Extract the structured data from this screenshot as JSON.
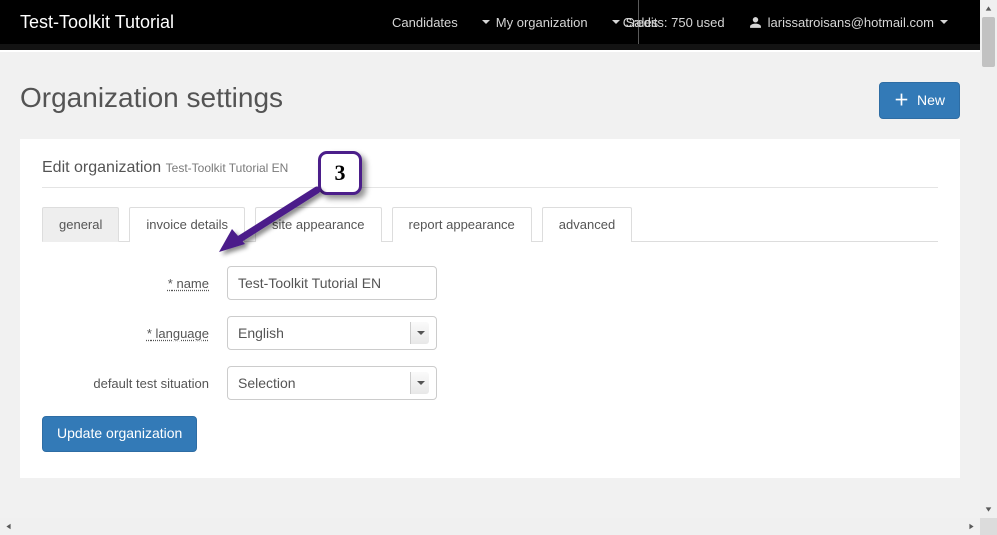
{
  "header": {
    "brand": "Test-Toolkit Tutorial",
    "nav_center": [
      {
        "label": "Candidates",
        "dropdown": false
      },
      {
        "label": "My organization",
        "dropdown": true
      },
      {
        "label": "Sales",
        "dropdown": true
      }
    ],
    "credits_label": "Credits: 750 used",
    "user_email": "larissatroisans@hotmail.com"
  },
  "page": {
    "title": "Organization settings",
    "new_button_label": "New"
  },
  "panel": {
    "heading": "Edit organization",
    "subheading": "Test-Toolkit Tutorial EN"
  },
  "tabs": [
    "general",
    "invoice details",
    "site appearance",
    "report appearance",
    "advanced"
  ],
  "form": {
    "name_label": "name",
    "name_value": "Test-Toolkit Tutorial EN",
    "language_label": "language",
    "language_value": "English",
    "default_situation_label": "default test situation",
    "default_situation_value": "Selection",
    "submit_label": "Update organization"
  },
  "callout": {
    "step": "3"
  }
}
